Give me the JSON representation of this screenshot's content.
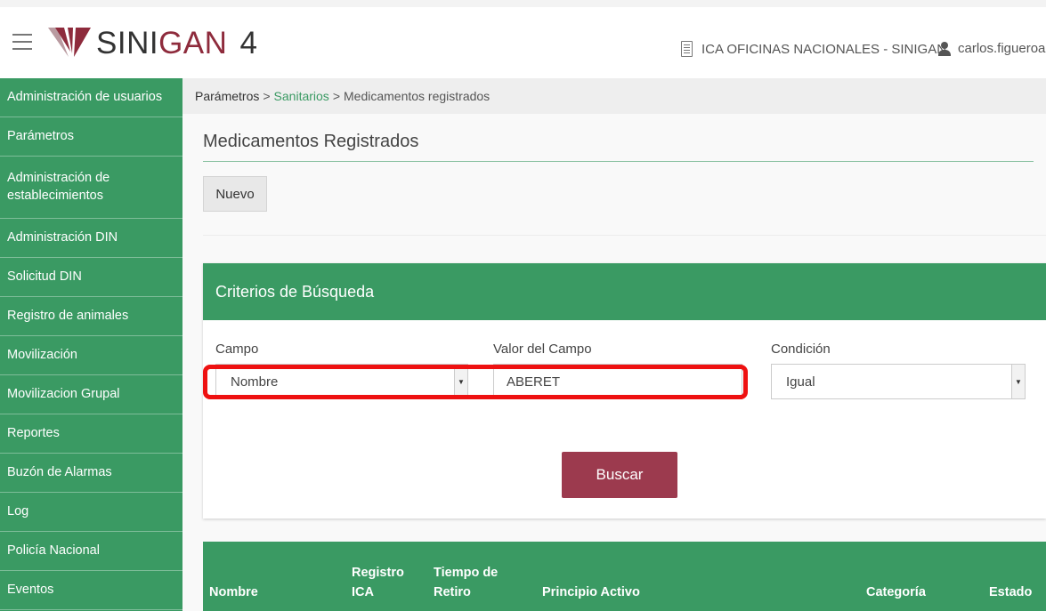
{
  "header": {
    "app_name_prefix": "SINI",
    "app_name_accent": "GAN",
    "version": "4",
    "office": "ICA OFICINAS NACIONALES - SINIGAN",
    "user": "carlos.figueroa",
    "user_caret": "▾"
  },
  "sidebar": {
    "items": [
      {
        "label": "Administración de usuarios"
      },
      {
        "label": "Parámetros"
      },
      {
        "label": "Administración de establecimientos"
      },
      {
        "label": "Administración DIN"
      },
      {
        "label": "Solicitud DIN"
      },
      {
        "label": "Registro de animales"
      },
      {
        "label": "Movilización"
      },
      {
        "label": "Movilizacion Grupal"
      },
      {
        "label": "Reportes"
      },
      {
        "label": "Buzón de Alarmas"
      },
      {
        "label": "Log"
      },
      {
        "label": "Policía Nacional"
      },
      {
        "label": "Eventos"
      }
    ]
  },
  "breadcrumb": {
    "root": "Parámetros",
    "sep": ">",
    "level2": "Sanitarios",
    "current": "Medicamentos registrados"
  },
  "page": {
    "title": "Medicamentos Registrados",
    "new_button": "Nuevo"
  },
  "search": {
    "title": "Criterios de Búsqueda",
    "field_label": "Campo",
    "field_value": "Nombre",
    "value_label": "Valor del Campo",
    "value_value": "ABERET",
    "condition_label": "Condición",
    "condition_value": "Igual",
    "search_button": "Buscar"
  },
  "table": {
    "col_nombre": "Nombre",
    "col_registro_1": "Registro",
    "col_registro_2": "ICA",
    "col_tiempo_1": "Tiempo de",
    "col_tiempo_2": "Retiro",
    "col_principio": "Principio Activo",
    "col_categoria": "Categoría",
    "col_estado": "Estado"
  },
  "colors": {
    "primary_green": "#3a9a63",
    "button_maroon": "#9c3a4e",
    "highlight_red": "#ee1111"
  },
  "icons": {
    "menu": "hamburger-icon",
    "office": "building-icon",
    "user": "user-icon",
    "select": "caret-icon"
  }
}
